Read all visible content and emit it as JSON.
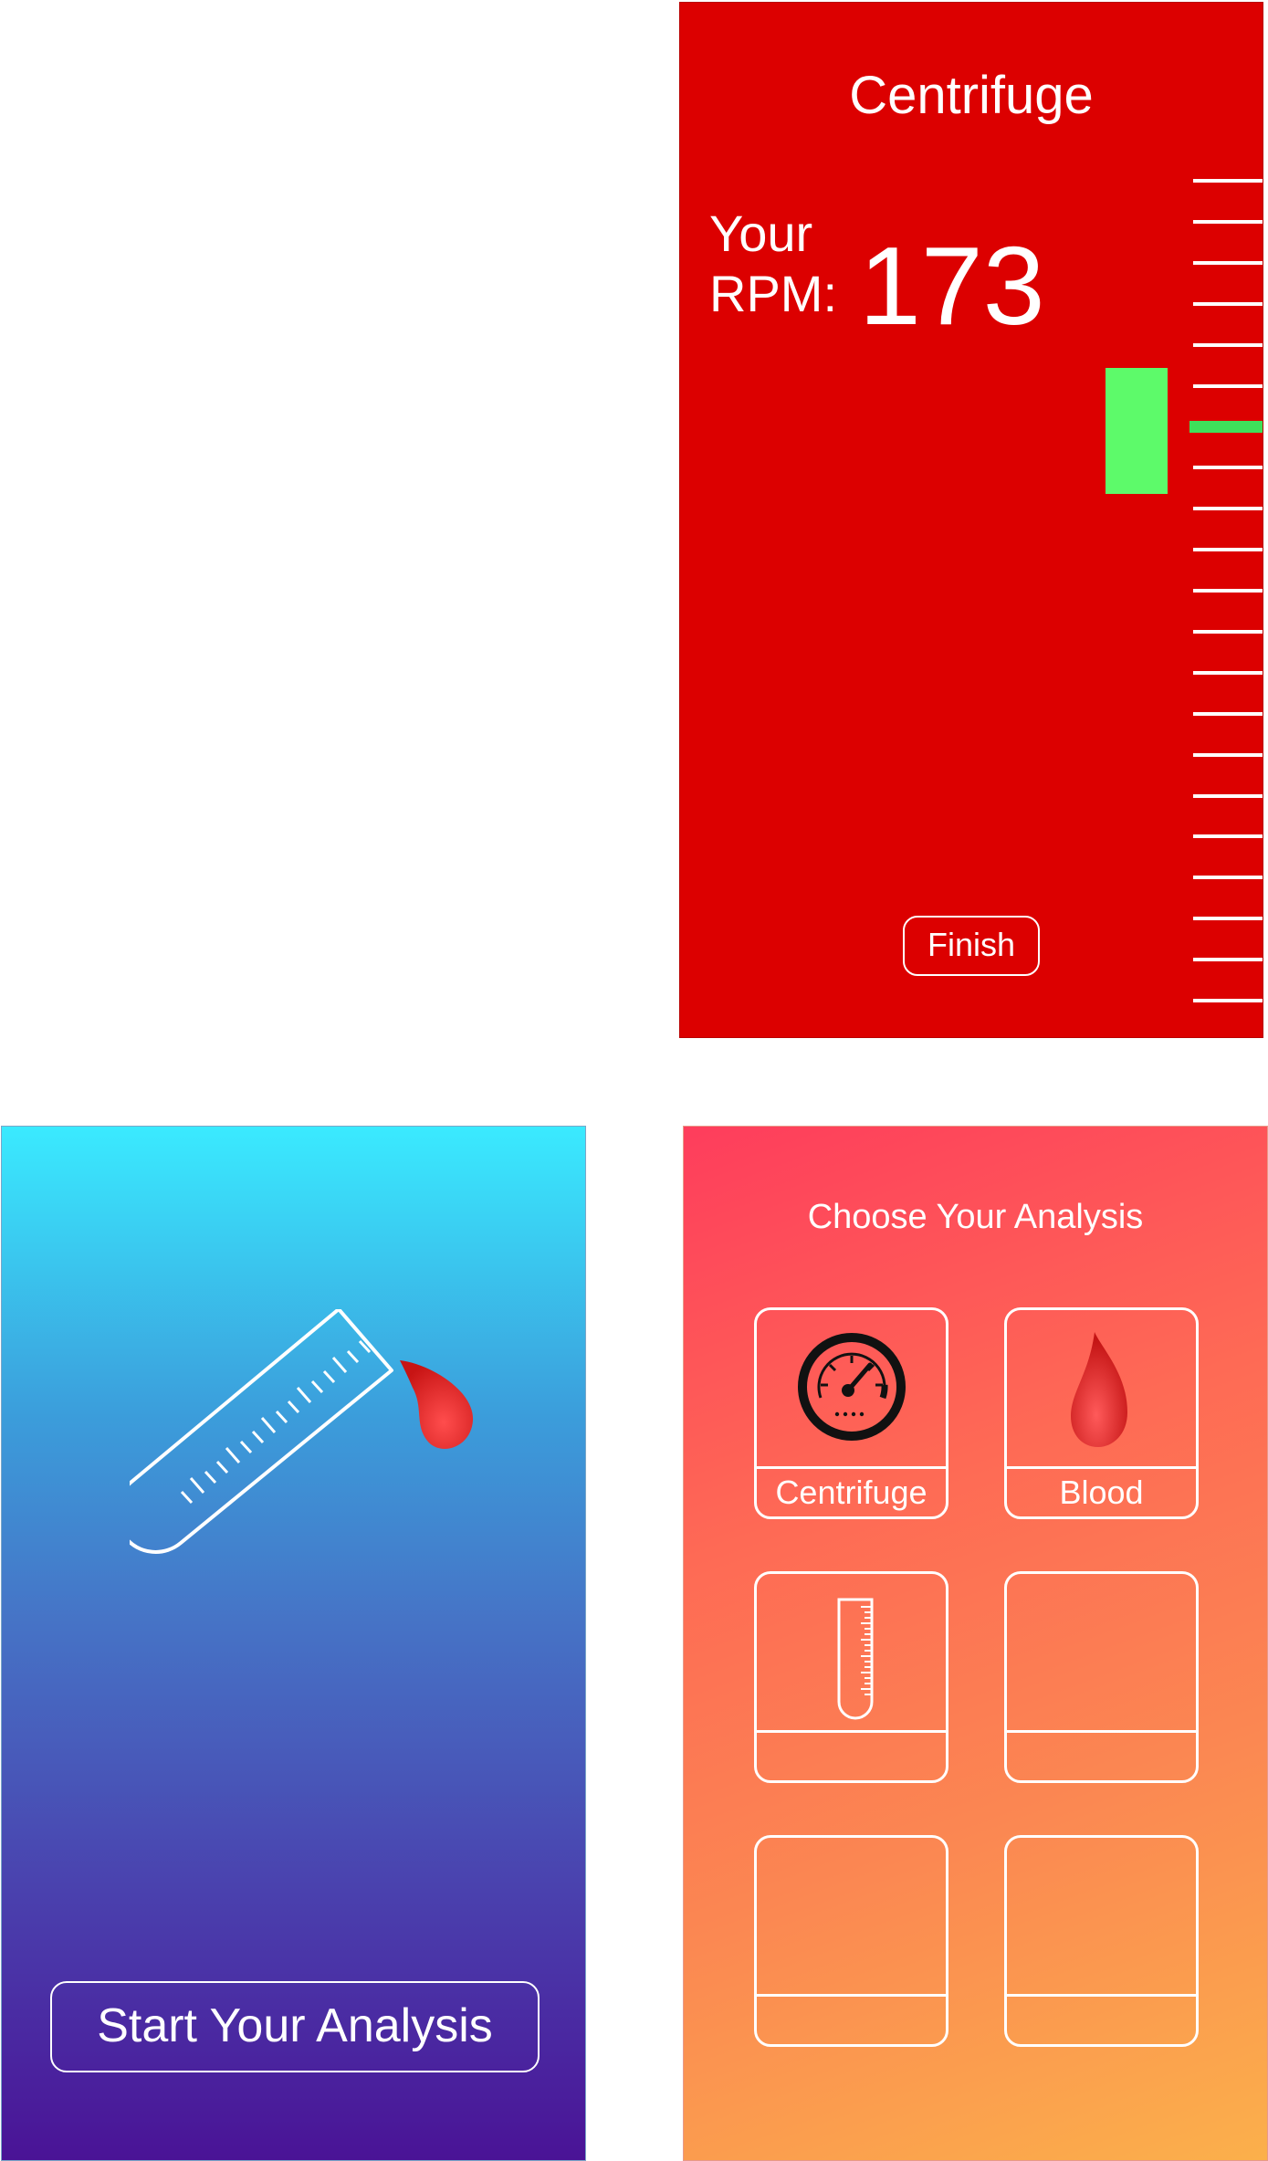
{
  "centrifuge": {
    "title": "Centrifuge",
    "rpm_label_line1": "Your",
    "rpm_label_line2": "RPM:",
    "rpm_value": "173",
    "finish_label": "Finish",
    "tick_count": 21,
    "active_tick_index": 6,
    "colors": {
      "background": "#dc0000",
      "indicator": "#5dfa6a",
      "active_tick": "#3ee05a"
    }
  },
  "welcome": {
    "start_label": "Start Your Analysis",
    "icons": [
      "test-tube-icon",
      "blood-drop-icon"
    ]
  },
  "choose": {
    "title": "Choose Your Analysis",
    "tiles": [
      {
        "label": "Centrifuge",
        "icon": "speedometer-icon"
      },
      {
        "label": "Blood",
        "icon": "blood-drop-icon"
      },
      {
        "label": "",
        "icon": "test-tube-icon"
      },
      {
        "label": "",
        "icon": ""
      },
      {
        "label": "",
        "icon": ""
      },
      {
        "label": "",
        "icon": ""
      }
    ]
  }
}
